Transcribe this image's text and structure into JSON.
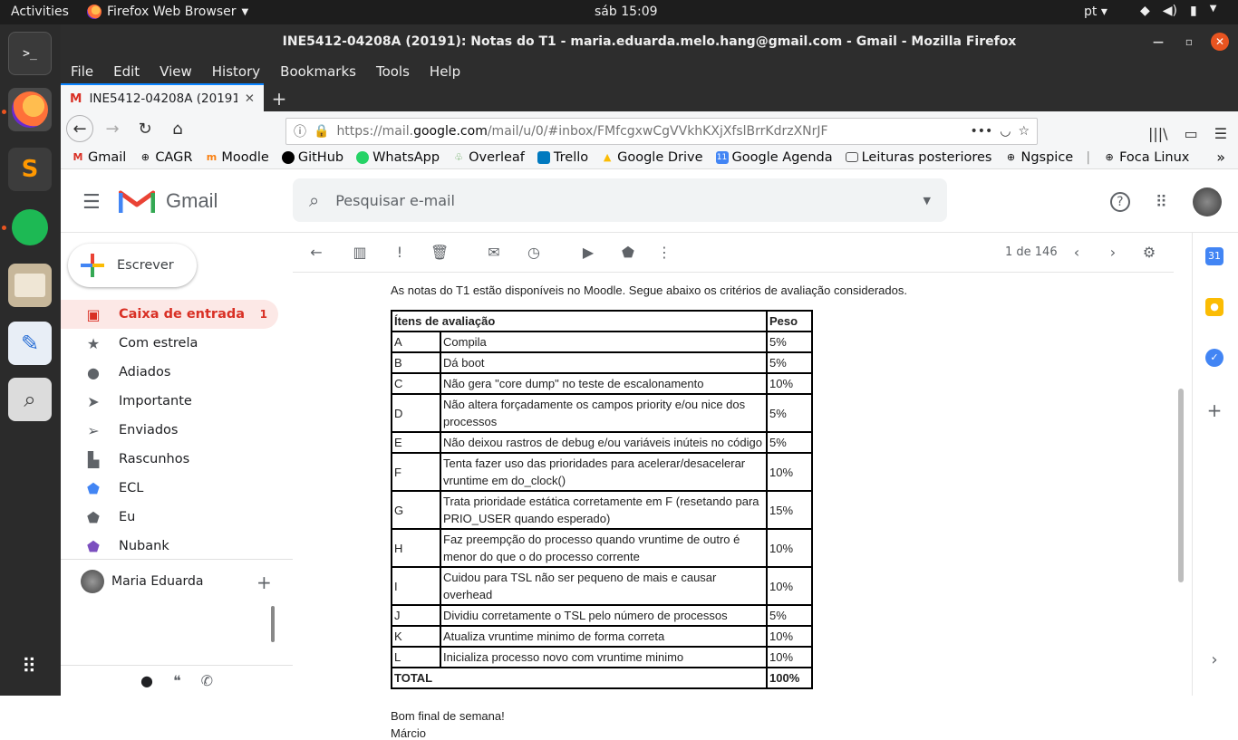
{
  "system": {
    "activities": "Activities",
    "app_name": "Firefox Web Browser",
    "clock": "sáb 15:09",
    "lang": "pt"
  },
  "window": {
    "title": "INE5412-04208A (20191): Notas do T1 - maria.eduarda.melo.hang@gmail.com - Gmail - Mozilla Firefox"
  },
  "menu": [
    "File",
    "Edit",
    "View",
    "History",
    "Bookmarks",
    "Tools",
    "Help"
  ],
  "tab": {
    "title": "INE5412-04208A (20191)"
  },
  "url": {
    "prefix": "https://mail.",
    "domain": "google.com",
    "path": "/mail/u/0/#inbox/FMfcgxwCgVVkhKXjXfslBrrKdrzXNrJF"
  },
  "bookmarks": [
    "Gmail",
    "CAGR",
    "Moodle",
    "GitHub",
    "WhatsApp",
    "Overleaf",
    "Trello",
    "Google Drive",
    "Google Agenda",
    "Leituras posteriores",
    "Ngspice",
    "Foca Linux"
  ],
  "gmail": {
    "title": "Gmail",
    "search_placeholder": "Pesquisar e-mail",
    "compose": "Escrever",
    "nav": [
      {
        "label": "Caixa de entrada",
        "count": "1",
        "icon": "inbox-icon"
      },
      {
        "label": "Com estrela",
        "icon": "star-icon"
      },
      {
        "label": "Adiados",
        "icon": "clock-icon"
      },
      {
        "label": "Importante",
        "icon": "important-icon"
      },
      {
        "label": "Enviados",
        "icon": "send-icon"
      },
      {
        "label": "Rascunhos",
        "icon": "draft-icon"
      },
      {
        "label": "ECL",
        "icon": "label-icon",
        "color": "#4285f4"
      },
      {
        "label": "Eu",
        "icon": "label-icon",
        "color": "#5f6368"
      },
      {
        "label": "Nubank",
        "icon": "label-icon",
        "color": "#7b4fbf"
      }
    ],
    "hangouts_user": "Maria Eduarda",
    "pager": "1 de 146"
  },
  "email": {
    "intro": "As notas do T1 estão disponíveis no Moodle. Segue abaixo os critérios de avaliação considerados.",
    "table_header": [
      "Ítens de avaliação",
      "Peso"
    ],
    "rows": [
      [
        "A",
        "Compila",
        "5%"
      ],
      [
        "B",
        "Dá boot",
        "5%"
      ],
      [
        "C",
        "Não gera \"core dump\" no teste de escalonamento",
        "10%"
      ],
      [
        "D",
        "Não altera forçadamente os campos priority e/ou nice dos processos",
        "5%"
      ],
      [
        "E",
        "Não deixou rastros de debug e/ou variáveis inúteis no código",
        "5%"
      ],
      [
        "F",
        "Tenta fazer uso das prioridades para acelerar/desacelerar vruntime em do_clock()",
        "10%"
      ],
      [
        "G",
        "Trata prioridade estática corretamente em F (resetando para PRIO_USER quando esperado)",
        "15%"
      ],
      [
        "H",
        "Faz preempção do processo quando vruntime de outro é menor do que o do processo corrente",
        "10%"
      ],
      [
        "I",
        "Cuidou para TSL não ser pequeno de mais e causar overhead",
        "10%"
      ],
      [
        "J",
        "Dividiu corretamente o TSL pelo número de processos",
        "5%"
      ],
      [
        "K",
        "Atualiza vruntime minimo de forma correta",
        "10%"
      ],
      [
        "L",
        "Inicializa processo novo com vruntime minimo",
        "10%"
      ]
    ],
    "total_label": "TOTAL",
    "total_value": "100%",
    "closing": "Bom final de semana!",
    "signature": "Márcio"
  }
}
